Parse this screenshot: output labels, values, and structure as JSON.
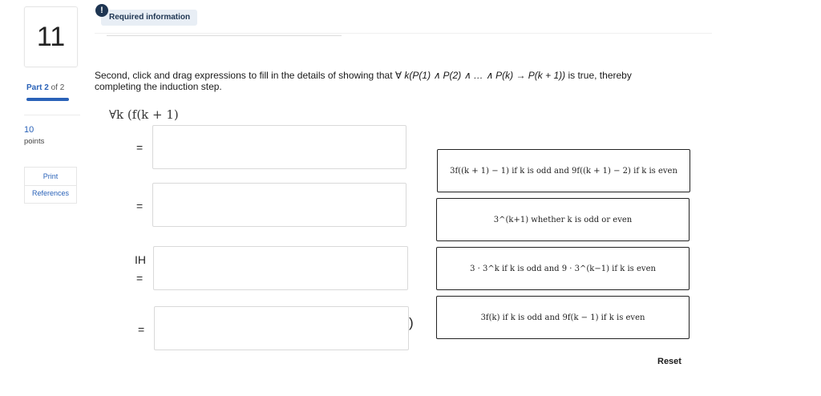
{
  "sidebar": {
    "question_number": "11",
    "part_label": "Part",
    "part_current": "2",
    "part_of": "of 2",
    "points_value": "10",
    "points_label": "points",
    "print_label": "Print",
    "references_label": "References"
  },
  "header": {
    "badge_icon": "!",
    "badge_label": "Required information"
  },
  "question": {
    "text_pre": "Second, click and drag expressions to fill in the details of showing that ∀ ",
    "formula": "k(P(1) ∧ P(2) ∧ … ∧ P(k) → P(k + 1))",
    "text_post": " is true, thereby completing the induction step."
  },
  "derivation": {
    "start_expr": "∀k (f(k + 1)",
    "rows": [
      {
        "label": "="
      },
      {
        "label": "="
      },
      {
        "label_top": "IH",
        "label": "="
      },
      {
        "label": "="
      }
    ],
    "closing_paren": ")"
  },
  "choices": [
    "3f((k + 1) − 1) if k is odd and 9f((k + 1) − 2) if k is even",
    "3^(k+1) whether k is odd or even",
    "3 · 3^k if k is odd and 9 · 3^(k−1) if k is even",
    "3f(k) if k is odd and 9f(k − 1) if k is even"
  ],
  "reset_label": "Reset"
}
